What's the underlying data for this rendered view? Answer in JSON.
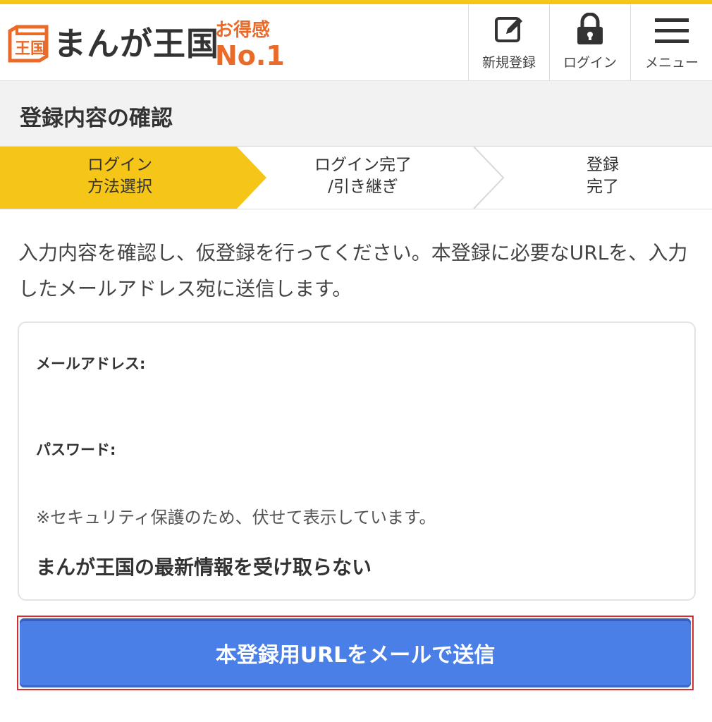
{
  "header": {
    "logo_text": "まんが王国",
    "logo_mark": "王国",
    "badge_top": "お得感",
    "badge_main": "No.1",
    "nav": [
      {
        "label": "新規登録",
        "icon": "edit-icon"
      },
      {
        "label": "ログイン",
        "icon": "lock-icon"
      },
      {
        "label": "メニュー",
        "icon": "hamburger-icon"
      }
    ]
  },
  "page_title": "登録内容の確認",
  "steps": [
    {
      "line1": "ログイン",
      "line2": "方法選択",
      "active": true
    },
    {
      "line1": "ログイン完了",
      "line2": "/引き継ぎ",
      "active": false
    },
    {
      "line1": "登録",
      "line2": "完了",
      "active": false
    }
  ],
  "intro_text": "入力内容を確認し、仮登録を行ってください。本登録に必要なURLを、入力したメールアドレス宛に送信します。",
  "form": {
    "email_label": "メールアドレス:",
    "password_label": "パスワード:",
    "security_note": "※セキュリティ保護のため、伏せて表示しています。",
    "newsletter_optout": "まんが王国の最新情報を受け取らない"
  },
  "submit_label": "本登録用URLをメールで送信",
  "colors": {
    "accent_yellow": "#f5c518",
    "brand_orange": "#ea6a2a",
    "button_blue": "#4a7fe8",
    "highlight_red": "#d32f2f"
  }
}
